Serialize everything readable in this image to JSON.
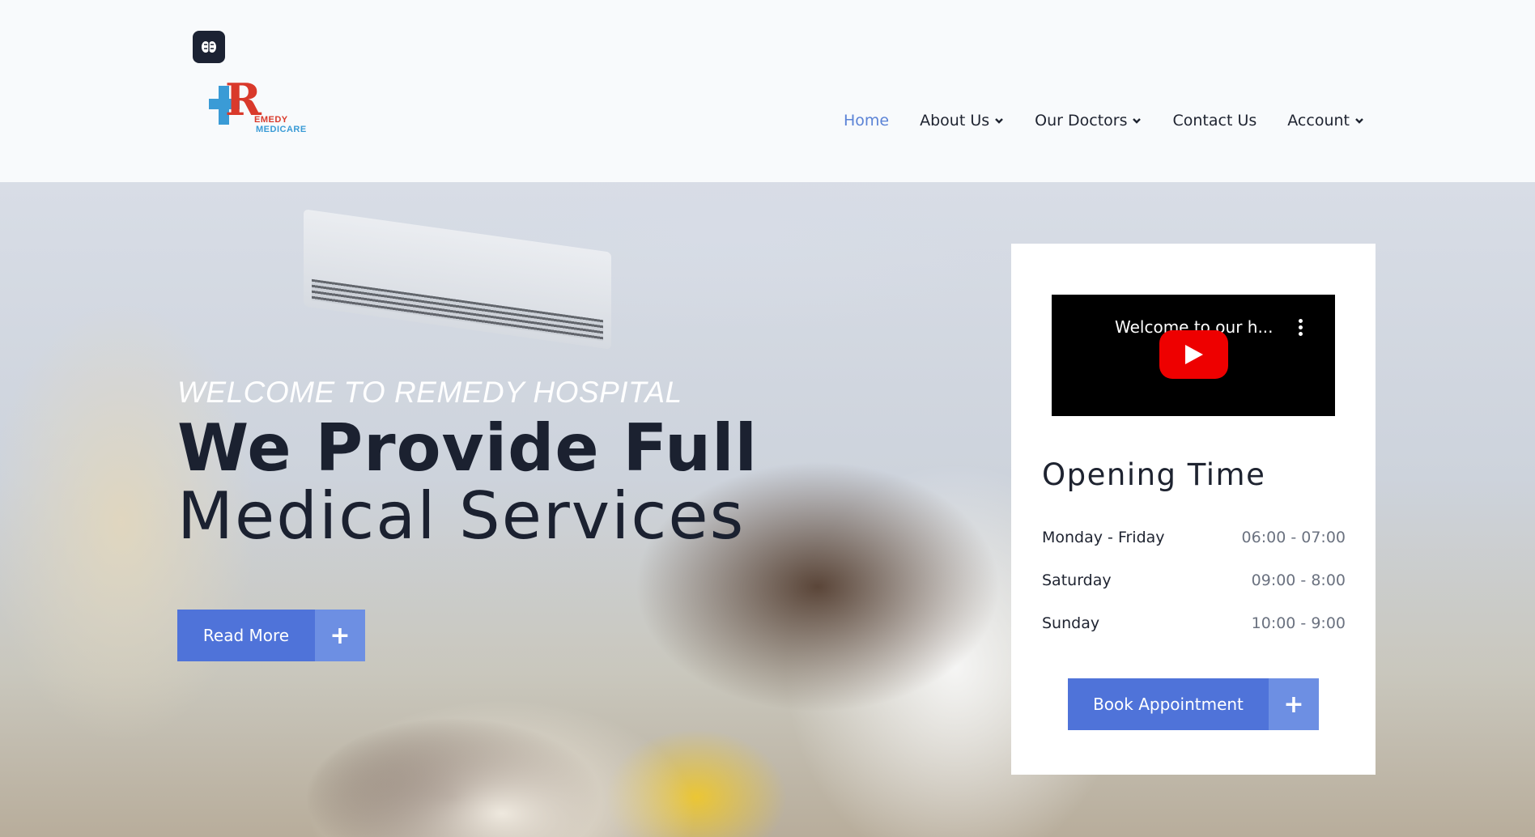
{
  "header": {
    "logo": {
      "letter": "R",
      "line1": "EMEDY",
      "line2": "MEDICARE"
    },
    "nav": [
      {
        "label": "Home",
        "active": true,
        "dropdown": false
      },
      {
        "label": "About Us",
        "active": false,
        "dropdown": true
      },
      {
        "label": "Our Doctors",
        "active": false,
        "dropdown": true
      },
      {
        "label": "Contact Us",
        "active": false,
        "dropdown": false
      },
      {
        "label": "Account",
        "active": false,
        "dropdown": true
      }
    ]
  },
  "hero": {
    "welcome": "WELCOME TO REMEDY HOSPITAL",
    "headline_line1": "We Provide Full",
    "headline_line2": "Medical Services",
    "read_more_label": "Read More",
    "plus": "+"
  },
  "card": {
    "video_title": "Welcome to our h...",
    "opening_title": "Opening Time",
    "hours": [
      {
        "day": "Monday - Friday",
        "time": "06:00 - 07:00"
      },
      {
        "day": "Saturday",
        "time": "09:00 - 8:00"
      },
      {
        "day": "Sunday",
        "time": "10:00 - 9:00"
      }
    ],
    "book_label": "Book Appointment",
    "plus": "+"
  },
  "colors": {
    "accent": "#4f73d9",
    "accent_light": "#6d8fe3",
    "nav_active": "#5b83d6",
    "dark": "#1b2130"
  }
}
